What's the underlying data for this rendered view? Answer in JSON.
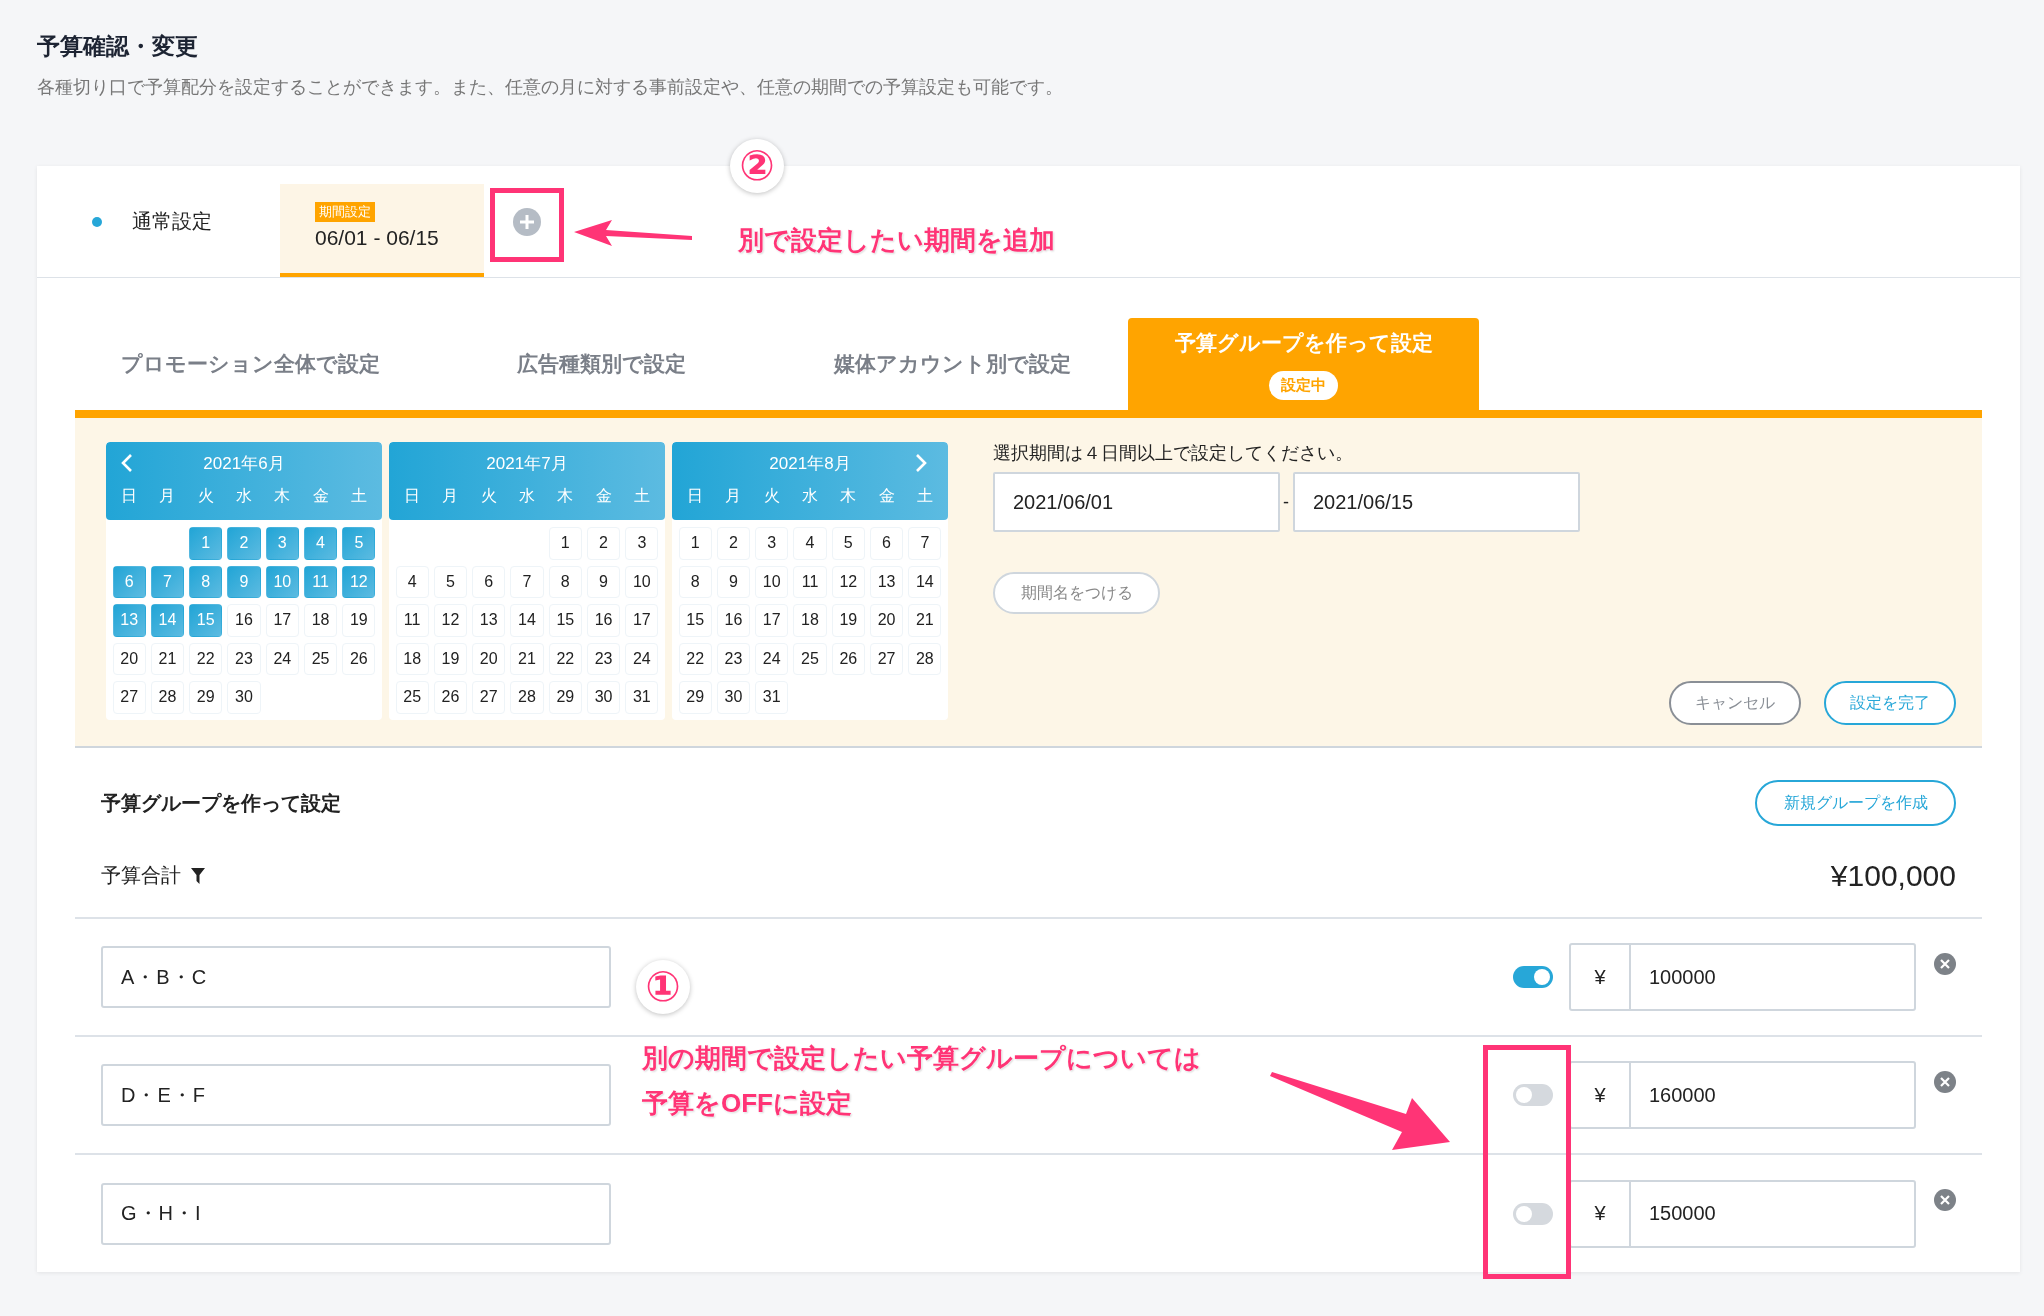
{
  "header": {
    "title": "予算確認・変更",
    "description": "各種切り口で予算配分を設定することができます。また、任意の月に対する事前設定や、任意の期間での予算設定も可能です。"
  },
  "period_tabs": [
    {
      "kind": "normal",
      "label": "通常設定",
      "selected": false
    },
    {
      "kind": "period",
      "badge": "期間設定",
      "label": "06/01 - 06/15",
      "selected": true
    }
  ],
  "period_annotation": {
    "number": "②",
    "text": "別で設定したい期間を追加"
  },
  "setting_tabs": [
    {
      "label": "プロモーション全体で設定",
      "selected": false
    },
    {
      "label": "広告種類別で設定",
      "selected": false
    },
    {
      "label": "媒体アカウント別で設定",
      "selected": false
    },
    {
      "label": "予算グループを作って設定",
      "selected": true,
      "badge": "設定中"
    }
  ],
  "calendars": [
    {
      "title": "2021年6月",
      "prev_arrow": true,
      "next_arrow": false,
      "weekdays": [
        "日",
        "月",
        "火",
        "水",
        "木",
        "金",
        "土"
      ],
      "weeks": [
        [
          {
            "kind": "blank"
          },
          {
            "kind": "blank"
          },
          {
            "label": "1",
            "selected": true
          },
          {
            "label": "2",
            "selected": true
          },
          {
            "label": "3",
            "selected": true
          },
          {
            "label": "4",
            "selected": true
          },
          {
            "label": "5",
            "selected": true
          }
        ],
        [
          {
            "label": "6",
            "selected": true
          },
          {
            "label": "7",
            "selected": true
          },
          {
            "label": "8",
            "selected": true
          },
          {
            "label": "9",
            "selected": true
          },
          {
            "label": "10",
            "selected": true
          },
          {
            "label": "11",
            "selected": true
          },
          {
            "label": "12",
            "selected": true
          }
        ],
        [
          {
            "label": "13",
            "selected": true
          },
          {
            "label": "14",
            "selected": true
          },
          {
            "label": "15",
            "selected": true
          },
          {
            "label": "16",
            "selected": false
          },
          {
            "label": "17",
            "selected": false
          },
          {
            "label": "18",
            "selected": false
          },
          {
            "label": "19",
            "selected": false
          }
        ],
        [
          {
            "label": "20",
            "selected": false
          },
          {
            "label": "21",
            "selected": false
          },
          {
            "label": "22",
            "selected": false
          },
          {
            "label": "23",
            "selected": false
          },
          {
            "label": "24",
            "selected": false
          },
          {
            "label": "25",
            "selected": false
          },
          {
            "label": "26",
            "selected": false
          }
        ],
        [
          {
            "label": "27",
            "selected": false
          },
          {
            "label": "28",
            "selected": false
          },
          {
            "label": "29",
            "selected": false
          },
          {
            "label": "30",
            "selected": false
          }
        ]
      ]
    },
    {
      "title": "2021年7月",
      "prev_arrow": false,
      "next_arrow": false,
      "weekdays": [
        "日",
        "月",
        "火",
        "水",
        "木",
        "金",
        "土"
      ],
      "weeks": [
        [
          {
            "kind": "blank"
          },
          {
            "kind": "blank"
          },
          {
            "kind": "blank"
          },
          {
            "kind": "blank"
          },
          {
            "label": "1",
            "selected": false
          },
          {
            "label": "2",
            "selected": false
          },
          {
            "label": "3",
            "selected": false
          }
        ],
        [
          {
            "label": "4",
            "selected": false
          },
          {
            "label": "5",
            "selected": false
          },
          {
            "label": "6",
            "selected": false
          },
          {
            "label": "7",
            "selected": false
          },
          {
            "label": "8",
            "selected": false
          },
          {
            "label": "9",
            "selected": false
          },
          {
            "label": "10",
            "selected": false
          }
        ],
        [
          {
            "label": "11",
            "selected": false
          },
          {
            "label": "12",
            "selected": false
          },
          {
            "label": "13",
            "selected": false
          },
          {
            "label": "14",
            "selected": false
          },
          {
            "label": "15",
            "selected": false
          },
          {
            "label": "16",
            "selected": false
          },
          {
            "label": "17",
            "selected": false
          }
        ],
        [
          {
            "label": "18",
            "selected": false
          },
          {
            "label": "19",
            "selected": false
          },
          {
            "label": "20",
            "selected": false
          },
          {
            "label": "21",
            "selected": false
          },
          {
            "label": "22",
            "selected": false
          },
          {
            "label": "23",
            "selected": false
          },
          {
            "label": "24",
            "selected": false
          }
        ],
        [
          {
            "label": "25",
            "selected": false
          },
          {
            "label": "26",
            "selected": false
          },
          {
            "label": "27",
            "selected": false
          },
          {
            "label": "28",
            "selected": false
          },
          {
            "label": "29",
            "selected": false
          },
          {
            "label": "30",
            "selected": false
          },
          {
            "label": "31",
            "selected": false
          }
        ]
      ]
    },
    {
      "title": "2021年8月",
      "prev_arrow": false,
      "next_arrow": true,
      "weekdays": [
        "日",
        "月",
        "火",
        "水",
        "木",
        "金",
        "土"
      ],
      "weeks": [
        [
          {
            "label": "1",
            "selected": false
          },
          {
            "label": "2",
            "selected": false
          },
          {
            "label": "3",
            "selected": false
          },
          {
            "label": "4",
            "selected": false
          },
          {
            "label": "5",
            "selected": false
          },
          {
            "label": "6",
            "selected": false
          },
          {
            "label": "7",
            "selected": false
          }
        ],
        [
          {
            "label": "8",
            "selected": false
          },
          {
            "label": "9",
            "selected": false
          },
          {
            "label": "10",
            "selected": false
          },
          {
            "label": "11",
            "selected": false
          },
          {
            "label": "12",
            "selected": false
          },
          {
            "label": "13",
            "selected": false
          },
          {
            "label": "14",
            "selected": false
          }
        ],
        [
          {
            "label": "15",
            "selected": false
          },
          {
            "label": "16",
            "selected": false
          },
          {
            "label": "17",
            "selected": false
          },
          {
            "label": "18",
            "selected": false
          },
          {
            "label": "19",
            "selected": false
          },
          {
            "label": "20",
            "selected": false
          },
          {
            "label": "21",
            "selected": false
          }
        ],
        [
          {
            "label": "22",
            "selected": false
          },
          {
            "label": "23",
            "selected": false
          },
          {
            "label": "24",
            "selected": false
          },
          {
            "label": "25",
            "selected": false
          },
          {
            "label": "26",
            "selected": false
          },
          {
            "label": "27",
            "selected": false
          },
          {
            "label": "28",
            "selected": false
          }
        ],
        [
          {
            "label": "29",
            "selected": false
          },
          {
            "label": "30",
            "selected": false
          },
          {
            "label": "31",
            "selected": false
          }
        ]
      ]
    }
  ],
  "period_form": {
    "hint": "選択期間は４日間以上で設定してください。",
    "start": "2021/06/01",
    "separator": "-",
    "end": "2021/06/15",
    "name_button": "期間名をつける",
    "buttons": [
      {
        "label": "キャンセル",
        "kind": "secondary"
      },
      {
        "label": "設定を完了",
        "kind": "primary"
      }
    ]
  },
  "groups": {
    "title": "予算グループを作って設定",
    "new_button": "新規グループを作成",
    "total_label": "予算合計",
    "total": "¥100,000",
    "rows": [
      {
        "name": "A・B・C",
        "on": true,
        "currency": "¥",
        "amount": "100000"
      },
      {
        "name": "D・E・F",
        "on": false,
        "currency": "¥",
        "amount": "160000"
      },
      {
        "name": "G・H・I",
        "on": false,
        "currency": "¥",
        "amount": "150000"
      }
    ],
    "annotation": {
      "number": "①",
      "lines": [
        "別の期間で設定したい予算グループについては",
        "予算をOFFに設定"
      ]
    }
  }
}
